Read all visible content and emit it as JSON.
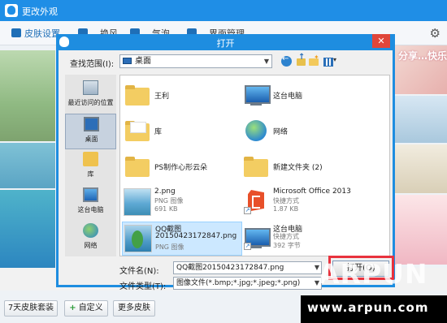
{
  "outer": {
    "title": "更改外观",
    "tabs": [
      {
        "label": "皮肤设置"
      },
      {
        "label": "…换风…"
      },
      {
        "label": "…气泡…"
      },
      {
        "label": "…界面管理"
      }
    ],
    "thumb_text": "分享…快乐",
    "buttons": {
      "seven_day": "7天皮肤套装",
      "custom": "自定义",
      "more": "更多皮肤"
    }
  },
  "dialog": {
    "title": "打开",
    "close": "✕",
    "lookin_label": "查找范围(I):",
    "lookin_value": "桌面",
    "places": [
      {
        "label": "最近访问的位置"
      },
      {
        "label": "桌面"
      },
      {
        "label": "库"
      },
      {
        "label": "这台电脑"
      },
      {
        "label": "网络"
      }
    ],
    "files": [
      {
        "name": "王利",
        "type": "folder"
      },
      {
        "name": "这台电脑",
        "type": "pc"
      },
      {
        "name": "库",
        "type": "folder"
      },
      {
        "name": "网络",
        "type": "network"
      },
      {
        "name": "PS制作心形云朵",
        "type": "folder"
      },
      {
        "name": "新建文件夹 (2)",
        "type": "folder"
      },
      {
        "name": "2.png",
        "sub1": "PNG 图像",
        "sub2": "691 KB",
        "type": "image"
      },
      {
        "name": "Microsoft Office 2013",
        "sub1": "快捷方式",
        "sub2": "1.87 KB",
        "type": "office"
      },
      {
        "name": "QQ截图",
        "name2": "20150423172847.png",
        "sub1": "PNG 图像",
        "type": "image"
      },
      {
        "name": "这台电脑",
        "sub1": "快捷方式",
        "sub2": "392 字节",
        "type": "pc"
      }
    ],
    "filename_label": "文件名(N):",
    "filename_value": "QQ截图20150423172847.png",
    "filetype_label": "文件类型(T):",
    "filetype_value": "图像文件(*.bmp;*.jpg;*.jpeg;*.png)",
    "open_button": "打开(O)"
  },
  "watermark": {
    "brand": "ARPUN",
    "url": "www.arpun.com"
  },
  "colors": {
    "title_blue": "#1f8ee6",
    "dialog_blue": "#1e8de0",
    "highlight_red": "#e8323d",
    "close_red": "#e0463a"
  }
}
